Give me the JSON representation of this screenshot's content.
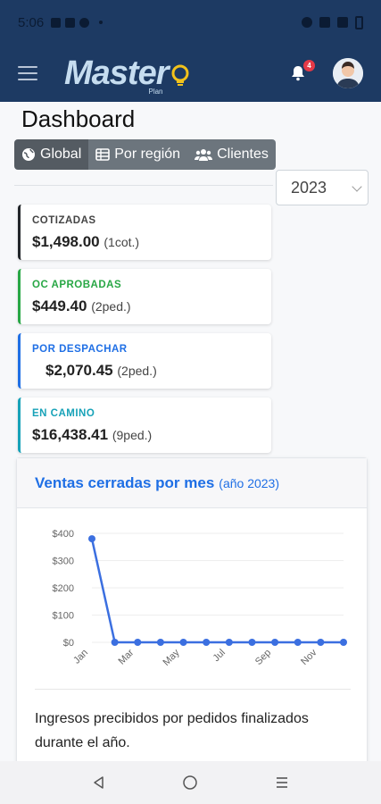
{
  "status_bar": {
    "time": "5:06"
  },
  "header": {
    "logo_text": "Master",
    "logo_sub": "Plan",
    "notification_count": "4",
    "menu_icon": "hamburger-icon",
    "bell_icon": "bell-icon",
    "avatar_icon": "user-avatar"
  },
  "page": {
    "title": "Dashboard"
  },
  "tabs": [
    {
      "label": "Global",
      "icon": "globe-icon",
      "active": true
    },
    {
      "label": "Por región",
      "icon": "table-icon",
      "active": false
    },
    {
      "label": "Clientes",
      "icon": "users-icon",
      "active": false
    }
  ],
  "year_select": {
    "value": "2023"
  },
  "kpis": [
    {
      "label": "COTIZADAS",
      "value": "$1,498.00",
      "sub": "(1cot.)",
      "color": "#212529"
    },
    {
      "label": "OC APROBADAS",
      "value": "$449.40",
      "sub": "(2ped.)",
      "color": "#28a745"
    },
    {
      "label": "POR DESPACHAR",
      "value": "$2,070.45",
      "sub": "(2ped.)",
      "color": "#1f6fe5"
    },
    {
      "label": "EN CAMINO",
      "value": "$16,438.41",
      "sub": "(9ped.)",
      "color": "#17a2b8"
    }
  ],
  "sales_card": {
    "title": "Ventas cerradas por mes",
    "subtitle": "(año 2023)",
    "description": "Ingresos precibidos por pedidos finalizados durante el año."
  },
  "chart_data": {
    "type": "line",
    "categories": [
      "Jan",
      "Feb",
      "Mar",
      "Apr",
      "May",
      "Jun",
      "Jul",
      "Aug",
      "Sep",
      "Oct",
      "Nov",
      "Dec"
    ],
    "tick_labels_shown": [
      "Jan",
      "Mar",
      "May",
      "Jul",
      "Sep",
      "Nov"
    ],
    "values": [
      380,
      0,
      0,
      0,
      0,
      0,
      0,
      0,
      0,
      0,
      0,
      0
    ],
    "y_ticks": [
      "$400",
      "$300",
      "$200",
      "$100",
      "$0"
    ],
    "ylim": [
      0,
      400
    ],
    "line_color": "#3b6fe0",
    "grid": true
  },
  "nav_bar": {
    "back_icon": "back-icon",
    "home_icon": "home-icon",
    "recents_icon": "recents-icon"
  }
}
